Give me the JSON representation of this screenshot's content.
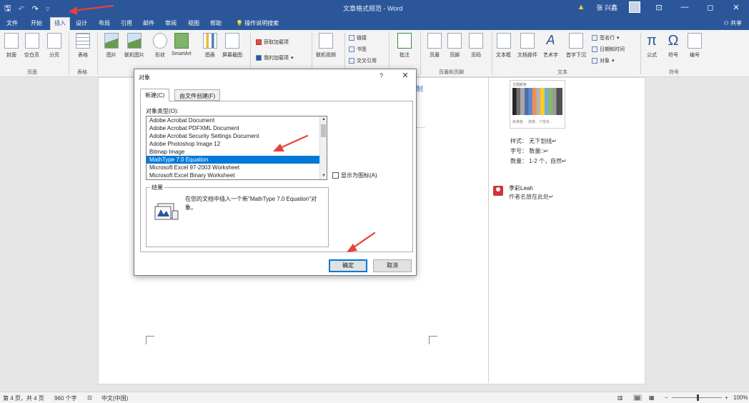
{
  "window": {
    "title": "文章格式规范 - Word",
    "user": "张 兴鑫",
    "ctl_ribbon": "⊡",
    "ctl_min": "—",
    "ctl_max": "◻",
    "ctl_close": "✕",
    "warning_icon": "warning-icon"
  },
  "qat": {
    "save": "🖫",
    "undo": "↶",
    "redo": "↷",
    "more": "▿"
  },
  "tabs": [
    "文件",
    "开始",
    "插入",
    "设计",
    "布局",
    "引用",
    "邮件",
    "审阅",
    "视图",
    "帮助"
  ],
  "active_tab": "插入",
  "tell_me": "操作说明搜索",
  "share": "共享",
  "ribbon": {
    "pages": {
      "cover": "封面",
      "blank": "空白页",
      "break": "分页",
      "group": "页面"
    },
    "tables": {
      "table": "表格",
      "group": "表格"
    },
    "illustrations": {
      "picture": "图片",
      "online_picture": "联机图片",
      "shapes": "形状",
      "smartart": "SmartArt",
      "chart": "图表",
      "screenshot": "屏幕截图"
    },
    "addins": {
      "get": "获取加载项",
      "my": "我的加载项"
    },
    "media": {
      "online_video": "联机视频"
    },
    "links": {
      "link": "链接",
      "bookmark": "书签",
      "cross_ref": "交叉引用"
    },
    "comments": {
      "comment": "批注"
    },
    "header_footer": {
      "header": "页眉",
      "footer": "页脚",
      "page_number": "页码",
      "group": "页眉和页脚"
    },
    "text": {
      "textbox": "文本框",
      "quick_parts": "文档部件",
      "wordart": "艺术字",
      "dropcap": "首字下沉",
      "signature": "签名行",
      "datetime": "日期和时间",
      "object": "对象",
      "group": "文本"
    },
    "symbols": {
      "equation": "公式",
      "symbol": "符号",
      "number": "编号",
      "group": "符号"
    }
  },
  "doc": {
    "blue_fragment": "制",
    "palette_title": "主题颜色",
    "palette_foot_left": "标准色",
    "palette_foot_right": "渐变、个性化...",
    "side_lines": [
      "样式：  无下划线↵",
      "字号：  数量□↵",
      "数量：  1-2 个，自然↵"
    ],
    "comment_author": "李彩Leah",
    "comment_text": "作者名放在此处↵"
  },
  "status": {
    "page": "第 4 页，共 4 页",
    "words": "960 个字",
    "lang": "中文(中国)",
    "zoom": "100%"
  },
  "dialog": {
    "title": "对象",
    "help": "?",
    "close": "✕",
    "tab_new": "新建(C)",
    "tab_file": "由文件创建(F)",
    "type_label": "对象类型(O):",
    "object_types": [
      "Adobe Acrobat Document",
      "Adobe Acrobat PDFXML Document",
      "Adobe Acrobat Security Settings Document",
      "Adobe Photoshop Image 12",
      "Bitmap Image",
      "MathType 7.0 Equation",
      "Microsoft Excel 97-2003 Worksheet",
      "Microsoft Excel Binary Worksheet"
    ],
    "selected": "MathType 7.0 Equation",
    "display_as_icon": "显示为图标(A)",
    "result_label": "结果",
    "result_text": "在您的文档中插入一个新\"MathType 7.0 Equation\"对象。",
    "ok": "确定",
    "cancel": "取消"
  },
  "colors": {
    "titlebar": "#2b579a",
    "selection": "#0078d7",
    "annotation": "#e8413a"
  }
}
